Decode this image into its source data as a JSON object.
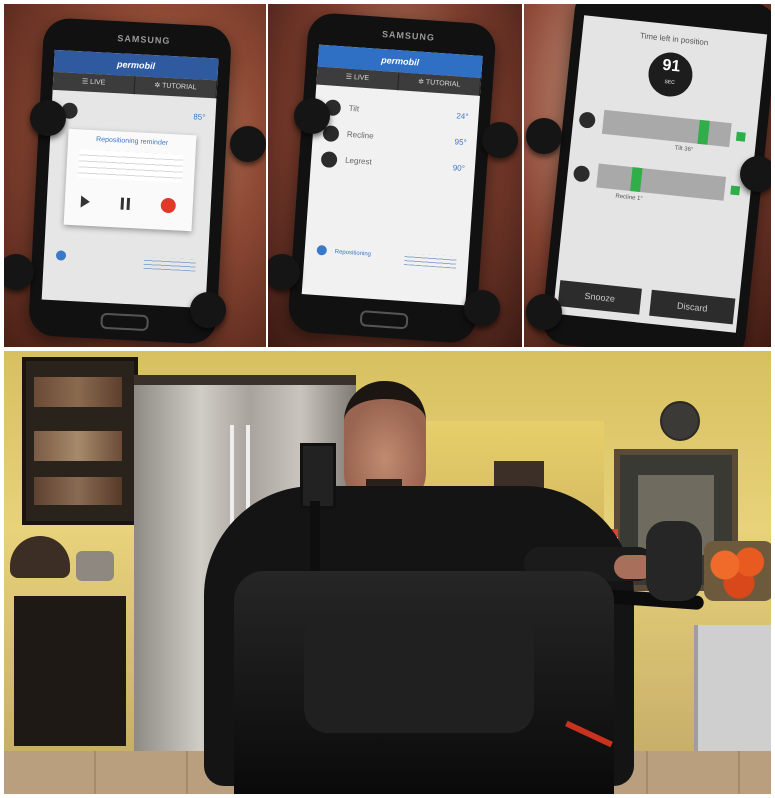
{
  "phone_brand": "SAMSUNG",
  "app_logo": "permobil",
  "left_screen": {
    "tabs": [
      "☰ LIVE",
      "✲ TUTORIAL"
    ],
    "row_value": "85°",
    "dialog_title": "Repositioning reminder"
  },
  "middle_screen": {
    "tabs": [
      "☰ LIVE",
      "✲ TUTORIAL"
    ],
    "rows": [
      {
        "label": "Tilt",
        "value": "24°"
      },
      {
        "label": "Recline",
        "value": "95°"
      },
      {
        "label": "Legrest",
        "value": "90°"
      }
    ],
    "footer_label": "Repositioning"
  },
  "right_screen": {
    "title": "Time left in position",
    "timer_value": "91",
    "timer_unit": "SEC",
    "bar1_label": "Tilt 36°",
    "bar2_label": "Recline 1°",
    "button_left": "Snooze",
    "button_right": "Discard"
  },
  "colors": {
    "app_blue": "#2f6fc4",
    "accent_green": "#2fae4a",
    "kitchen_wall": "#e6cf6a"
  }
}
